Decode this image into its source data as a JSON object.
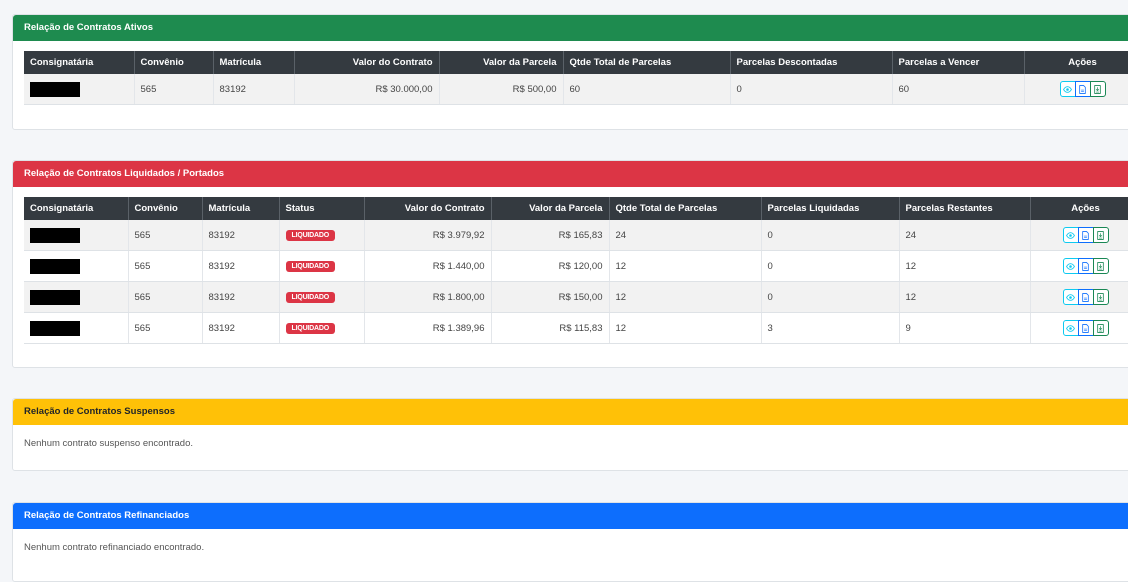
{
  "ativos": {
    "title": "Relação de Contratos Ativos",
    "headers": {
      "consignataria": "Consignatária",
      "convenio": "Convênio",
      "matricula": "Matrícula",
      "valor_contrato": "Valor do Contrato",
      "valor_parcela": "Valor da Parcela",
      "qtde_total": "Qtde Total de Parcelas",
      "descontadas": "Parcelas Descontadas",
      "a_vencer": "Parcelas a Vencer",
      "acoes": "Ações"
    },
    "rows": [
      {
        "convenio": "565",
        "matricula": "83192",
        "valor_contrato": "R$ 30.000,00",
        "valor_parcela": "R$ 500,00",
        "qtde_total": "60",
        "descontadas": "0",
        "a_vencer": "60"
      }
    ]
  },
  "liquidados": {
    "title": "Relação de Contratos Liquidados / Portados",
    "headers": {
      "consignataria": "Consignatária",
      "convenio": "Convênio",
      "matricula": "Matrícula",
      "status": "Status",
      "valor_contrato": "Valor do Contrato",
      "valor_parcela": "Valor da Parcela",
      "qtde_total": "Qtde Total de Parcelas",
      "liquidadas": "Parcelas Liquidadas",
      "restantes": "Parcelas Restantes",
      "acoes": "Ações"
    },
    "rows": [
      {
        "convenio": "565",
        "matricula": "83192",
        "status": "LIQUIDADO",
        "valor_contrato": "R$ 3.979,92",
        "valor_parcela": "R$ 165,83",
        "qtde_total": "24",
        "liquidadas": "0",
        "restantes": "24"
      },
      {
        "convenio": "565",
        "matricula": "83192",
        "status": "LIQUIDADO",
        "valor_contrato": "R$ 1.440,00",
        "valor_parcela": "R$ 120,00",
        "qtde_total": "12",
        "liquidadas": "0",
        "restantes": "12"
      },
      {
        "convenio": "565",
        "matricula": "83192",
        "status": "LIQUIDADO",
        "valor_contrato": "R$ 1.800,00",
        "valor_parcela": "R$ 150,00",
        "qtde_total": "12",
        "liquidadas": "0",
        "restantes": "12"
      },
      {
        "convenio": "565",
        "matricula": "83192",
        "status": "LIQUIDADO",
        "valor_contrato": "R$ 1.389,96",
        "valor_parcela": "R$ 115,83",
        "qtde_total": "12",
        "liquidadas": "3",
        "restantes": "9"
      }
    ]
  },
  "suspensos": {
    "title": "Relação de Contratos Suspensos",
    "empty_message": "Nenhum contrato suspenso encontrado."
  },
  "refinanciados": {
    "title": "Relação de Contratos Refinanciados",
    "empty_message": "Nenhum contrato refinanciado encontrado."
  },
  "action_icons": [
    "eye-icon",
    "file-pdf-icon",
    "file-export-icon"
  ],
  "colors": {
    "ativos_header": "#1e8b4f",
    "liquidados_header": "#dc3545",
    "suspensos_header": "#ffc107",
    "refinanciados_header": "#0d6efd",
    "table_head": "#343a40",
    "status_badge": "#dc3545"
  }
}
